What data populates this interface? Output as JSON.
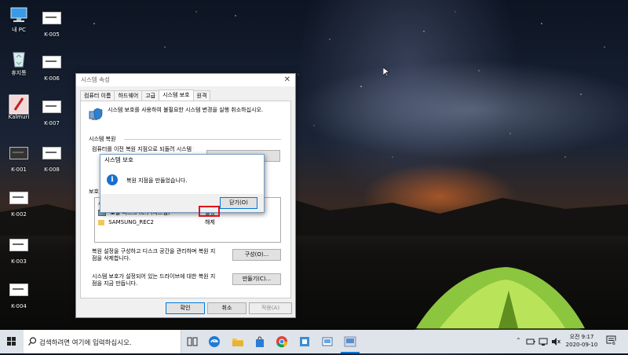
{
  "desktop": {
    "icons": [
      {
        "label": "내 PC",
        "icon": "this-pc-icon"
      },
      {
        "label": "휴지통",
        "icon": "recycle-bin-icon"
      },
      {
        "label": "Kalmuri",
        "icon": "kalmuri-app-icon"
      },
      {
        "label": "K-001",
        "icon": "file-icon"
      },
      {
        "label": "K-002",
        "icon": "file-icon"
      },
      {
        "label": "K-003",
        "icon": "file-icon"
      },
      {
        "label": "K-004",
        "icon": "file-icon"
      },
      {
        "label": "K-005",
        "icon": "file-icon"
      },
      {
        "label": "K-006",
        "icon": "file-icon"
      },
      {
        "label": "K-007",
        "icon": "file-icon"
      },
      {
        "label": "K-008",
        "icon": "file-icon"
      }
    ]
  },
  "window": {
    "title": "시스템 속성",
    "tabs": [
      "컴퓨터 이름",
      "하드웨어",
      "고급",
      "시스템 보호",
      "원격"
    ],
    "active_tab": "시스템 보호",
    "description": "시스템 보호를 사용하여 불필요한 시스템 변경을 실행 취소하십시오.",
    "restore_group": "시스템 복원",
    "restore_text_partial": "컴퓨터를 이전 복원 지점으로 되돌려 시스템 변경...",
    "protection_group": "보호 설정",
    "list_header_partial": "사",
    "drives": [
      {
        "name": "로컬 디스크 (C:) (시스템)",
        "status": "설정"
      },
      {
        "name": "SAMSUNG_REC2",
        "status": "해제"
      }
    ],
    "configure_text": "복원 설정을 구성하고 디스크 공간을 관리하며 복원 지점을 삭제합니다.",
    "configure_button": "구성(O)...",
    "create_text": "시스템 보호가 설정되어 있는 드라이브에 대한 복원 지점을 지금 만듭니다.",
    "create_button": "만들기(C)...",
    "ok_button": "확인",
    "cancel_button": "취소",
    "apply_button": "적용(A)"
  },
  "popup": {
    "title": "시스템 보호",
    "message": "복원 지점을 만들었습니다.",
    "close_button": "닫기(O)"
  },
  "taskbar": {
    "search_placeholder": "검색하려면 여기에 입력하십시오.",
    "time": "오전 9:17",
    "date": "2020-09-10",
    "notification_count": "6"
  },
  "colors": {
    "accent": "#0078d7",
    "highlight_box": "#e0101c",
    "info_icon": "#1a6fd0",
    "tent_glow": "#a6e23a"
  }
}
